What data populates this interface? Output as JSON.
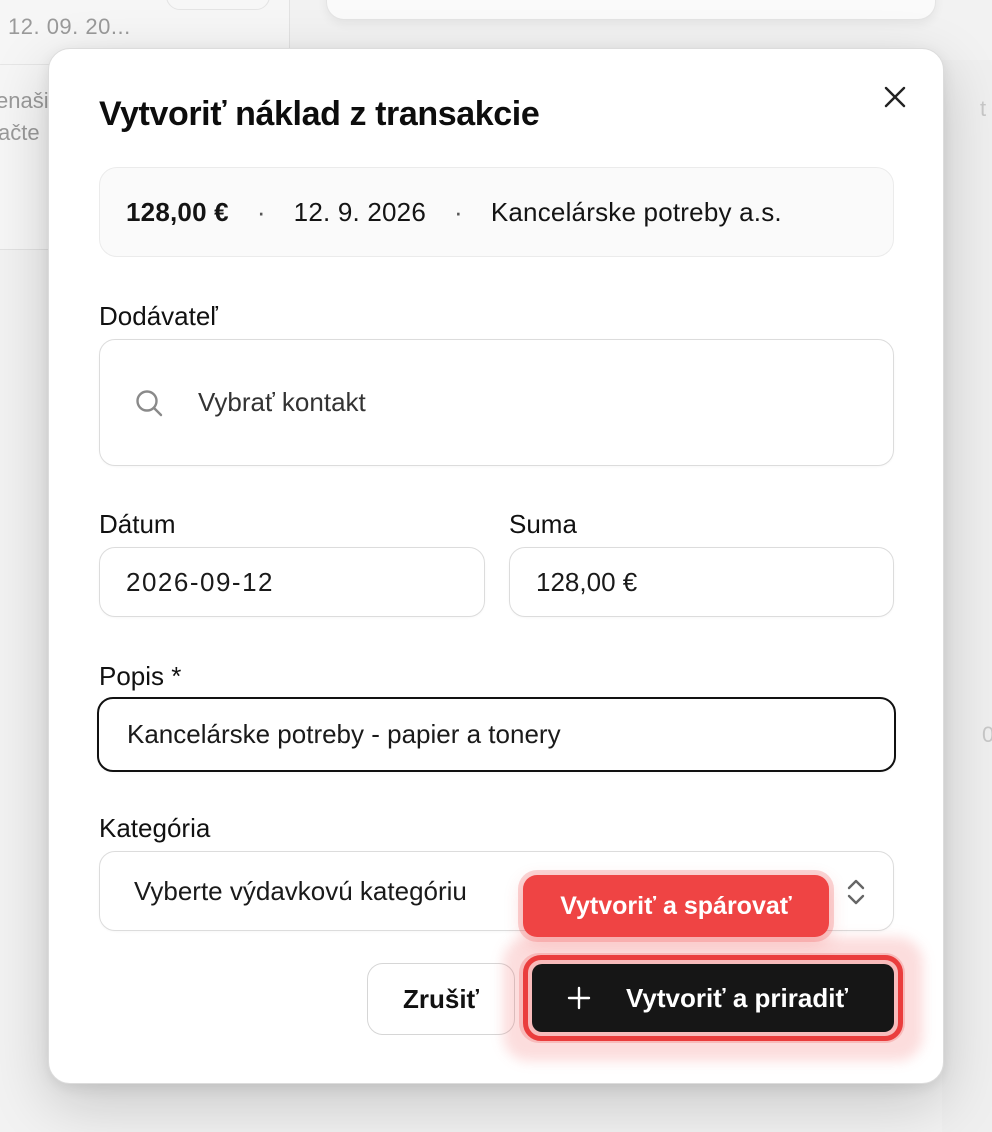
{
  "background": {
    "date_text": "12. 09. 20...",
    "text_line_1": "enaši",
    "text_line_2": "ačte",
    "right_glyph_1": "t",
    "right_glyph_2": "0"
  },
  "modal": {
    "title": "Vytvoriť náklad z transakcie",
    "close_icon": "close-icon",
    "summary": {
      "amount": "128,00 €",
      "separator": "·",
      "date": "12. 9. 2026",
      "counterparty": "Kancelárske potreby a.s."
    },
    "supplier": {
      "label": "Dodávateľ",
      "placeholder": "Vybrať kontakt",
      "icon": "search-icon"
    },
    "date": {
      "label": "Dátum",
      "value": "2026-09-12"
    },
    "amount": {
      "label": "Suma",
      "value": "128,00 €"
    },
    "description": {
      "label": "Popis *",
      "value": "Kancelárske potreby - papier a tonery"
    },
    "category": {
      "label": "Kategória",
      "placeholder": "Vyberte výdavkovú kategóriu",
      "icon": "chevron-updown-icon"
    },
    "buttons": {
      "cancel_label": "Zrušiť",
      "primary_label": "Vytvoriť a priradiť",
      "primary_icon": "plus-icon"
    },
    "tooltip": "Vytvoriť a spárovať"
  },
  "colors": {
    "accent_red": "#ef4444",
    "primary_dark": "#161616"
  }
}
